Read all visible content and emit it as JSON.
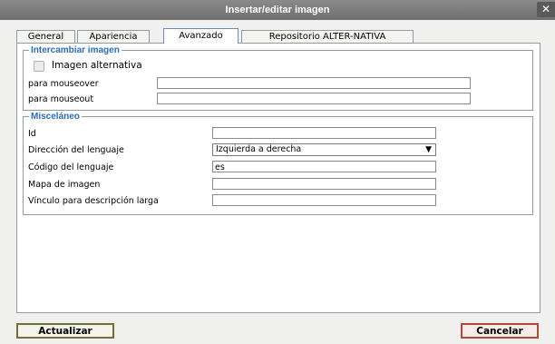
{
  "window": {
    "title": "Insertar/editar imagen",
    "close_icon": "close-icon"
  },
  "tabs": [
    {
      "label": "General"
    },
    {
      "label": "Apariencia"
    },
    {
      "label": "Avanzado",
      "active": true
    },
    {
      "label": "Repositorio ALTER-NATIVA"
    }
  ],
  "swap": {
    "legend": "Intercambiar imagen",
    "alt_checkbox_label": "Imagen alternativa",
    "mouseover_label": "para mouseover",
    "mouseover_value": "",
    "mouseout_label": "para mouseout",
    "mouseout_value": ""
  },
  "misc": {
    "legend": "Misceláneo",
    "id_label": "Id",
    "id_value": "",
    "dir_label": "Dirección del lenguaje",
    "dir_value": "Izquierda a derecha",
    "lang_label": "Código del lenguaje",
    "lang_value": "es",
    "map_label": "Mapa de imagen",
    "map_value": "",
    "longdesc_label": "Vínculo para descripción larga",
    "longdesc_value": ""
  },
  "buttons": {
    "update": "Actualizar",
    "cancel": "Cancelar"
  }
}
